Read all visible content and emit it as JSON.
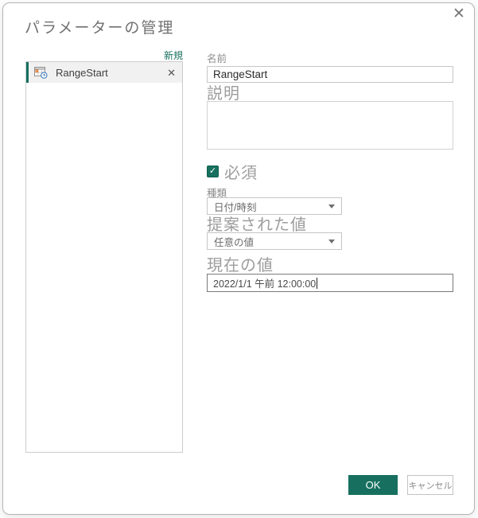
{
  "accent_color": "#17705F",
  "window": {
    "title": "パラメーターの管理",
    "close_glyph": "✕"
  },
  "sidebar": {
    "new_link": "新規",
    "delete_glyph": "✕",
    "items": [
      {
        "label": "RangeStart",
        "icon": "datetime-parameter-icon",
        "selected": true
      }
    ]
  },
  "form": {
    "name_label": "名前",
    "name_value": "RangeStart",
    "description_label": "説明",
    "description_value": "",
    "required_label": "必須",
    "required_checked": true,
    "check_glyph": "✓",
    "type_label": "種類",
    "type_value": "日付/時刻",
    "suggested_label": "提案された値",
    "suggested_value": "任意の値",
    "current_label": "現在の値",
    "current_value": "2022/1/1 午前 12:00:00"
  },
  "footer": {
    "ok_label": "OK",
    "cancel_label": "キャンセル"
  }
}
